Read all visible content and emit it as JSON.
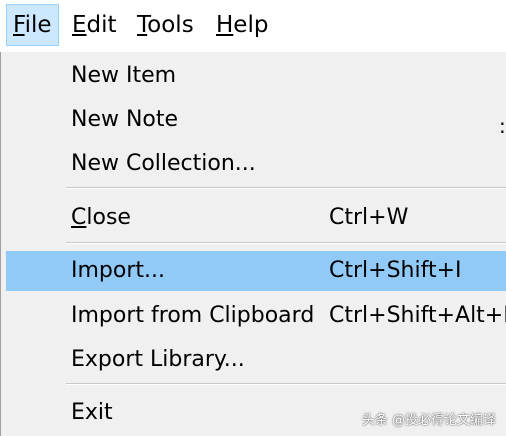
{
  "menubar": {
    "items": [
      {
        "mnemonic": "F",
        "rest": "ile",
        "active": true
      },
      {
        "mnemonic": "E",
        "rest": "dit",
        "active": false
      },
      {
        "mnemonic": "T",
        "rest": "ools",
        "active": false
      },
      {
        "mnemonic": "H",
        "rest": "elp",
        "active": false
      }
    ]
  },
  "menu": {
    "items": [
      {
        "label": "New Item",
        "shortcut": ""
      },
      {
        "label": "New Note",
        "shortcut": ""
      },
      {
        "label": "New Collection...",
        "shortcut": ""
      },
      {
        "mnemonic": "C",
        "rest": "lose",
        "shortcut": "Ctrl+W"
      },
      {
        "label": "Import...",
        "shortcut": "Ctrl+Shift+I",
        "highlighted": true
      },
      {
        "label": "Import from Clipboard",
        "shortcut": "Ctrl+Shift+Alt+I"
      },
      {
        "label": "Export Library...",
        "shortcut": ""
      },
      {
        "label": "Exit",
        "shortcut": ""
      }
    ],
    "overflow_mark": ":"
  },
  "watermark": "头条 @投必得论文编译",
  "colors": {
    "menubar_active_bg": "#cce8ff",
    "menubar_active_border": "#99d1ff",
    "menu_bg": "#f0f0f0",
    "highlight_bg": "#91c9f7"
  }
}
